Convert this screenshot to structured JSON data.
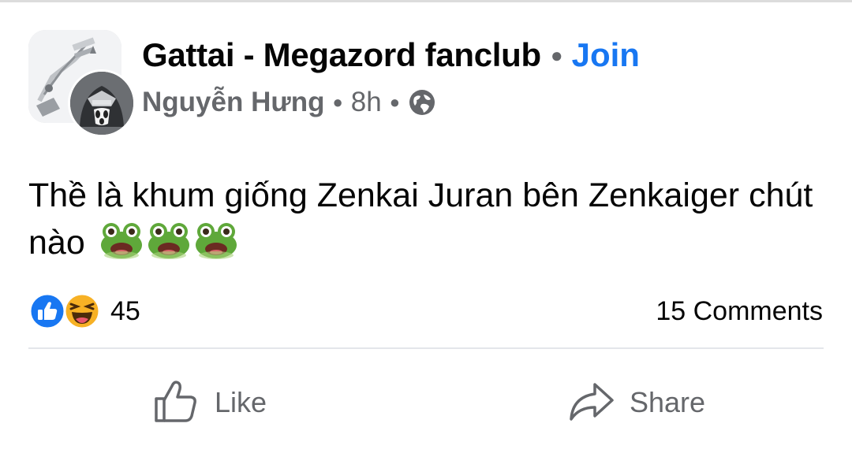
{
  "post": {
    "group_name": "Gattai - Megazord fanclub",
    "join_label": "Join",
    "author": "Nguyễn Hưng",
    "time": "8h",
    "privacy_icon": "globe-icon",
    "text": "Thề là khum giống Zenkai Juran bên Zenkaiger chút nào",
    "emojis": [
      "frog-emoji",
      "frog-emoji",
      "frog-emoji"
    ]
  },
  "stats": {
    "reaction_icons": [
      "like-reaction-icon",
      "haha-reaction-icon"
    ],
    "reaction_count": "45",
    "comments": "15 Comments"
  },
  "actions": {
    "like_label": "Like",
    "share_label": "Share"
  },
  "colors": {
    "accent": "#1877f2",
    "secondary_text": "#65676b",
    "primary_text": "#050505",
    "divider": "#e4e6eb",
    "haha": "#f7b125"
  }
}
